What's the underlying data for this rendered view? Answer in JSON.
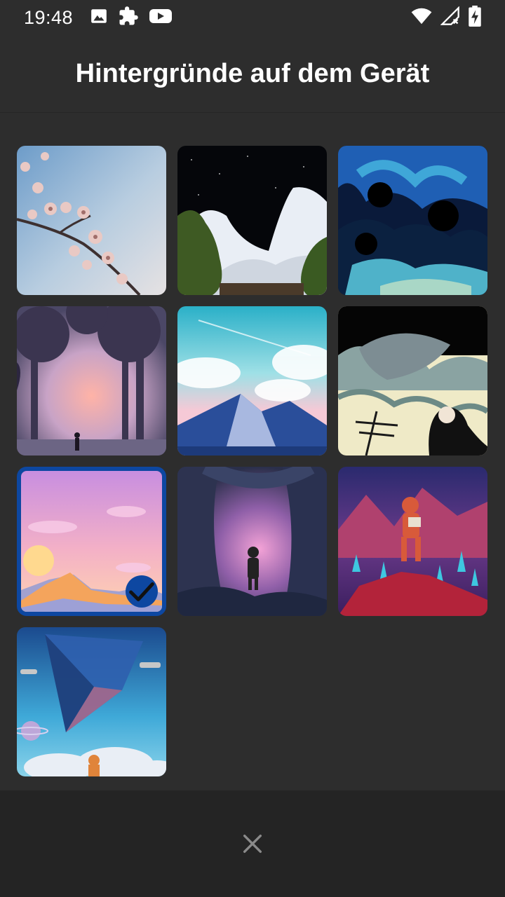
{
  "status_bar": {
    "time": "19:48",
    "left_icons": [
      "image-icon",
      "puzzle-icon",
      "youtube-icon"
    ],
    "right_icons": [
      "wifi-icon",
      "cell-signal-icon",
      "battery-charging-icon"
    ]
  },
  "header": {
    "title": "Hintergründe auf dem Gerät"
  },
  "wallpapers": [
    {
      "name": "cherry-blossom",
      "selected": false
    },
    {
      "name": "night-clouds",
      "selected": false
    },
    {
      "name": "blue-swirl-clouds",
      "selected": false
    },
    {
      "name": "sunset-forest-wanderer",
      "selected": false
    },
    {
      "name": "pastel-mountains",
      "selected": false
    },
    {
      "name": "whale-waves-girl",
      "selected": false
    },
    {
      "name": "pink-sky-mountains",
      "selected": true
    },
    {
      "name": "jungle-astronaut",
      "selected": false
    },
    {
      "name": "red-crystal-astronaut",
      "selected": false
    },
    {
      "name": "sky-pyramid-ships",
      "selected": false
    }
  ],
  "colors": {
    "background": "#2d2d2d",
    "bottom_bar": "#242424",
    "accent": "#0d47a1"
  },
  "bottom_bar": {
    "close_icon": "close-icon"
  }
}
